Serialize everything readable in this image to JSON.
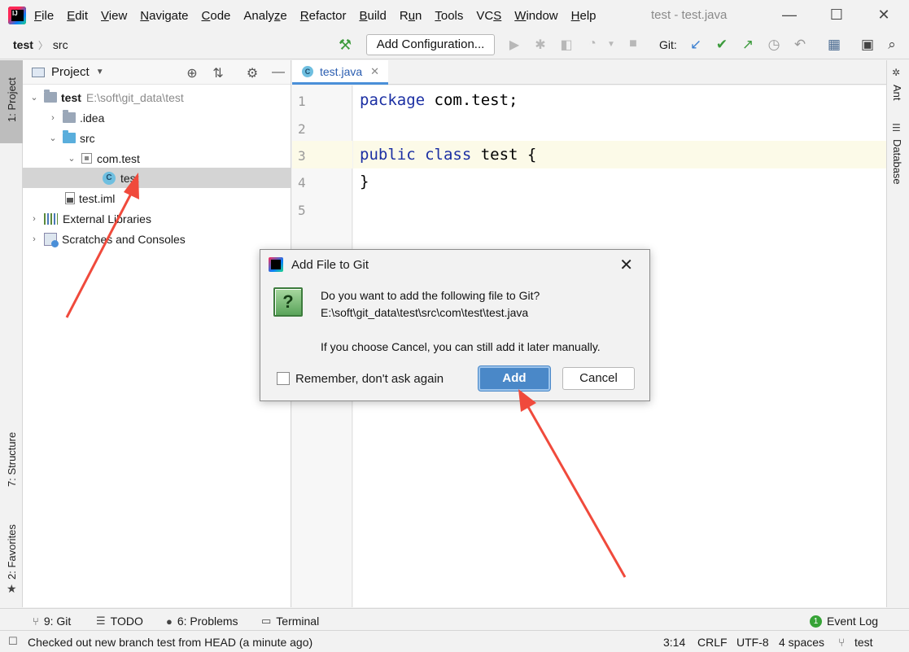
{
  "window": {
    "title": "test - test.java",
    "minimize": "—",
    "maximize": "☐",
    "close": "✕"
  },
  "menu": [
    {
      "pre": "",
      "ul": "F",
      "post": "ile"
    },
    {
      "pre": "",
      "ul": "E",
      "post": "dit"
    },
    {
      "pre": "",
      "ul": "V",
      "post": "iew"
    },
    {
      "pre": "",
      "ul": "N",
      "post": "avigate"
    },
    {
      "pre": "",
      "ul": "C",
      "post": "ode"
    },
    {
      "pre": "Analy",
      "ul": "z",
      "post": "e"
    },
    {
      "pre": "",
      "ul": "R",
      "post": "efactor"
    },
    {
      "pre": "",
      "ul": "B",
      "post": "uild"
    },
    {
      "pre": "R",
      "ul": "u",
      "post": "n"
    },
    {
      "pre": "",
      "ul": "T",
      "post": "ools"
    },
    {
      "pre": "VC",
      "ul": "S",
      "post": ""
    },
    {
      "pre": "",
      "ul": "W",
      "post": "indow"
    },
    {
      "pre": "",
      "ul": "H",
      "post": "elp"
    }
  ],
  "breadcrumb": {
    "project": "test",
    "sep": "〉",
    "folder": "src"
  },
  "toolbar": {
    "add_configuration": "Add Configuration...",
    "git_label": "Git:"
  },
  "left_stripe": {
    "project_tab": "1: Project",
    "structure_tab": "7: Structure",
    "favorites_tab": "2: Favorites"
  },
  "right_stripe": {
    "ant_tab": "Ant",
    "database_tab": "Database"
  },
  "project_panel": {
    "title": "Project",
    "tree": [
      {
        "label": "test",
        "detail": "E:\\soft\\git_data\\test"
      },
      {
        "label": ".idea"
      },
      {
        "label": "src"
      },
      {
        "label": "com.test"
      },
      {
        "label": "test"
      },
      {
        "label": "test.iml"
      },
      {
        "label": "External Libraries"
      },
      {
        "label": "Scratches and Consoles"
      }
    ]
  },
  "editor": {
    "tab_label": "test.java",
    "line_numbers": [
      "1",
      "2",
      "3",
      "4",
      "5"
    ],
    "lines": [
      {
        "kw": "package",
        "rest": " com.test;"
      },
      {
        "kw": "",
        "rest": ""
      },
      {
        "kw": "public class",
        "rest": " test {"
      },
      {
        "kw": "",
        "rest": "}"
      },
      {
        "kw": "",
        "rest": ""
      }
    ]
  },
  "dialog": {
    "title": "Add File to Git",
    "question": "Do you want to add the following file to Git?",
    "path": "E:\\soft\\git_data\\test\\src\\com\\test\\test.java",
    "hint": "If you choose Cancel, you can still add it later manually.",
    "remember_label": "Remember, don't ask again",
    "add_label": "Add",
    "cancel_label": "Cancel"
  },
  "bottom_tools": {
    "git": "9: Git",
    "todo": "TODO",
    "problems": "6: Problems",
    "terminal": "Terminal",
    "event_log": "Event Log"
  },
  "status": {
    "message": "Checked out new branch test from HEAD (a minute ago)",
    "position": "3:14",
    "line_sep": "CRLF",
    "encoding": "UTF-8",
    "indent": "4 spaces",
    "branch": "test"
  },
  "colors": {
    "accent": "#4a88c8",
    "keyword": "#1b2fa3",
    "annotation_arrow": "#f04a3c"
  }
}
